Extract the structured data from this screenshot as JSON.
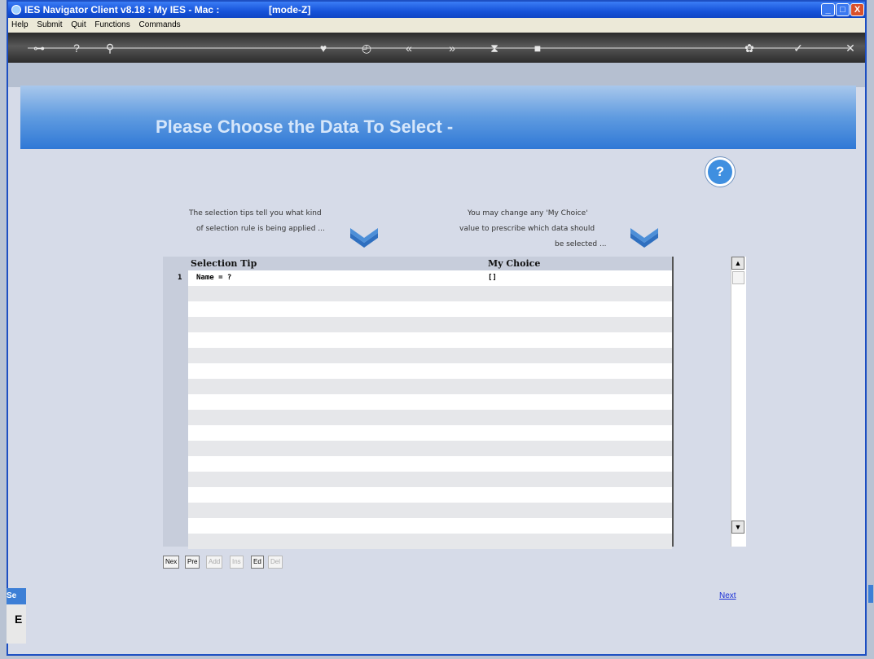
{
  "window": {
    "title": "IES Navigator Client v8.18 : My IES - Mac :",
    "mode": "[mode-Z]",
    "controls": [
      "_",
      "□",
      "X"
    ]
  },
  "menu": [
    "Help",
    "Submit",
    "Quit",
    "Functions",
    "Commands"
  ],
  "toolbar_icons": [
    "key-icon",
    "help-icon",
    "search-icon",
    "heart-icon",
    "history-icon",
    "rewind-icon",
    "forward-icon",
    "hourglass-icon",
    "stop-icon",
    "settings-icon",
    "check-icon",
    "close-icon"
  ],
  "banner": {
    "heading": "Please Choose the Data To Select -"
  },
  "tips": {
    "left_line1": "The selection tips tell you what kind",
    "left_line2": "of selection rule is being applied ...",
    "right_line1": "You may change any 'My Choice'",
    "right_line2": "value to prescribe which data should",
    "right_line3": "be selected ..."
  },
  "grid": {
    "columns": [
      "Selection Tip",
      "My Choice"
    ],
    "rows": [
      {
        "num": "1",
        "tip": "Name = ?",
        "choice": "[]"
      }
    ]
  },
  "buttons": [
    {
      "label": "Nex",
      "enabled": true
    },
    {
      "label": "Pre",
      "enabled": true
    },
    {
      "label": "Add",
      "enabled": false
    },
    {
      "label": "Ins",
      "enabled": false
    },
    {
      "label": "Ed",
      "enabled": true
    },
    {
      "label": "Del",
      "enabled": false
    }
  ],
  "next_link": "Next",
  "side": {
    "tab": "Se",
    "panel": "E"
  }
}
